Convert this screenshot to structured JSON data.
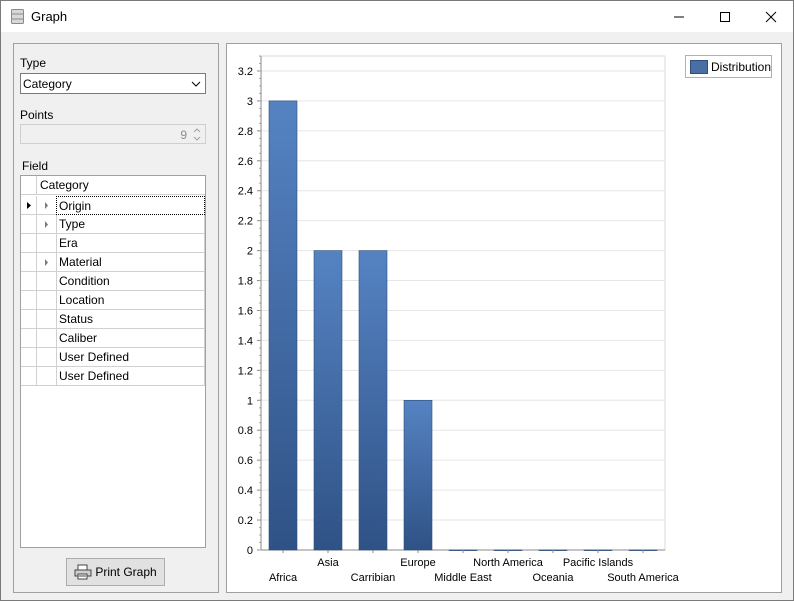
{
  "window": {
    "title": "Graph",
    "icons": {
      "app": "database-icon",
      "minimize": "minimize-icon",
      "maximize": "maximize-icon",
      "close": "close-icon"
    }
  },
  "left": {
    "type_label": "Type",
    "type_value": "Category",
    "points_label": "Points",
    "points_value": "9",
    "field_label": "Field",
    "grid_header": "Category",
    "fields": [
      {
        "label": "Origin",
        "expandable": true,
        "current": true
      },
      {
        "label": "Type",
        "expandable": true,
        "current": false
      },
      {
        "label": "Era",
        "expandable": false,
        "current": false
      },
      {
        "label": "Material",
        "expandable": true,
        "current": false
      },
      {
        "label": "Condition",
        "expandable": false,
        "current": false
      },
      {
        "label": "Location",
        "expandable": false,
        "current": false
      },
      {
        "label": "Status",
        "expandable": false,
        "current": false
      },
      {
        "label": "Caliber",
        "expandable": false,
        "current": false
      },
      {
        "label": "User Defined",
        "expandable": false,
        "current": false
      },
      {
        "label": "User Defined",
        "expandable": false,
        "current": false
      }
    ],
    "print_button": "Print Graph"
  },
  "chart_data": {
    "type": "bar",
    "categories": [
      "Africa",
      "Asia",
      "Carribian",
      "Europe",
      "Middle East",
      "North America",
      "Oceania",
      "Pacific Islands",
      "South America"
    ],
    "series": [
      {
        "name": "Distribution",
        "values": [
          3,
          2,
          2,
          1,
          0,
          0,
          0,
          0,
          0
        ]
      }
    ],
    "ylim": [
      0,
      3.3
    ],
    "yticks": [
      "0",
      "0.2",
      "0.4",
      "0.6",
      "0.8",
      "1",
      "1.2",
      "1.4",
      "1.6",
      "1.8",
      "2",
      "2.2",
      "2.4",
      "2.6",
      "2.8",
      "3",
      "3.2"
    ],
    "grid": true,
    "legend": "top-right",
    "bar_color": "#4a6fa5"
  }
}
